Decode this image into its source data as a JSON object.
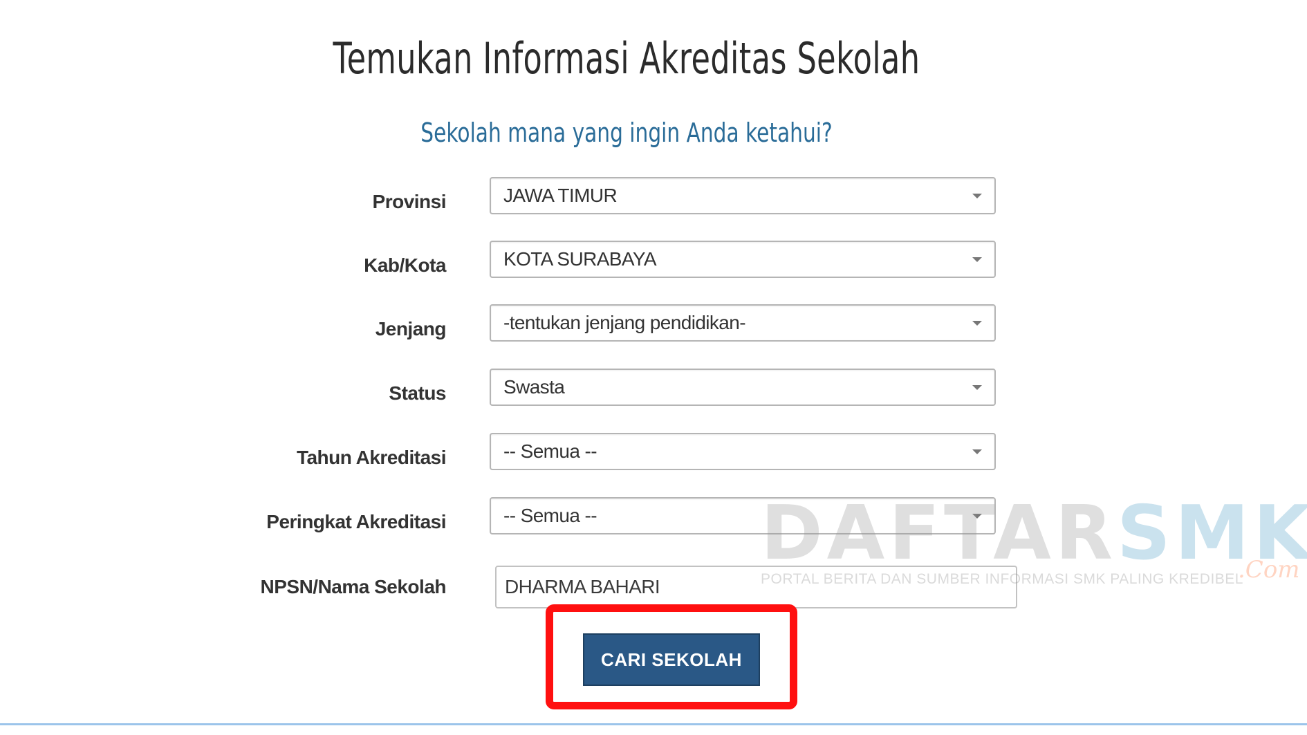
{
  "header": {
    "title": "Temukan Informasi Akreditas Sekolah",
    "subtitle": "Sekolah mana yang ingin Anda ketahui?"
  },
  "form": {
    "provinsi": {
      "label": "Provinsi",
      "value": "JAWA TIMUR"
    },
    "kabkota": {
      "label": "Kab/Kota",
      "value": "KOTA SURABAYA"
    },
    "jenjang": {
      "label": "Jenjang",
      "value": "-tentukan jenjang pendidikan-"
    },
    "status": {
      "label": "Status",
      "value": "Swasta"
    },
    "tahun_akreditasi": {
      "label": "Tahun Akreditasi",
      "value": "-- Semua --"
    },
    "peringkat_akreditasi": {
      "label": "Peringkat Akreditasi",
      "value": "-- Semua --"
    },
    "npsn": {
      "label": "NPSN/Nama Sekolah",
      "value": "DHARMA BAHARI"
    },
    "submit_label": "CARI SEKOLAH"
  },
  "watermark": {
    "part1": "DAFTAR",
    "part2": "SMK",
    "suffix": ".Com",
    "tagline": "PORTAL BERITA DAN SUMBER INFORMASI SMK PALING KREDIBEL"
  },
  "colors": {
    "title": "#2b2b2b",
    "subtitle": "#2a6c98",
    "button": "#2a5886",
    "highlight": "#ff1010",
    "bottom_line": "#9cc4ea"
  },
  "icons": {
    "dropdown": "caret-down-icon"
  }
}
